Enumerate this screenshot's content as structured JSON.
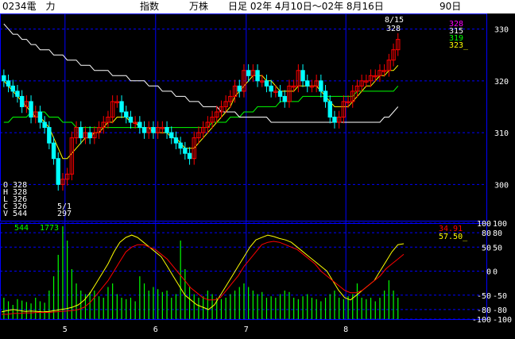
{
  "header": {
    "code_name": "0234電　力",
    "index_label": "指数",
    "unit_label": "万株",
    "period_label": "日足 02年 4月10日～02年 8月16日",
    "days_label": "90日"
  },
  "colors": {
    "background": "#000000",
    "grid": "#0000ff",
    "candle_up": "#ff0000",
    "candle_down": "#00ffff",
    "ma_short": "#ffff00",
    "ma_mid": "#00ff00",
    "ma_long": "#ffffff",
    "ma_extra": "#ff00ff",
    "volume": "#00ff00",
    "osc_fast": "#ffff00",
    "osc_slow": "#ff0000",
    "axis_text": "#ffffff"
  },
  "chart_data": [
    {
      "type": "candlestick",
      "title": "",
      "ylim": [
        293,
        333
      ],
      "yticks": [
        300,
        310,
        320,
        330
      ],
      "x_months": [
        {
          "label": "5",
          "index": 14
        },
        {
          "label": "6",
          "index": 34
        },
        {
          "label": "7",
          "index": 54
        },
        {
          "label": "8",
          "index": 76
        }
      ],
      "closes": [
        320,
        319,
        318,
        317,
        315,
        316,
        313,
        314,
        312,
        311,
        308,
        305,
        300,
        301,
        302,
        309,
        311,
        309,
        310,
        309,
        310,
        311,
        312,
        313,
        316,
        316,
        314,
        313,
        312,
        312,
        311,
        310,
        311,
        310,
        311,
        311,
        310,
        309,
        308,
        307,
        306,
        305,
        309,
        310,
        311,
        312,
        313,
        314,
        315,
        316,
        317,
        319,
        318,
        322,
        321,
        322,
        320,
        320,
        319,
        318,
        318,
        317,
        316,
        319,
        319,
        322,
        320,
        319,
        319,
        320,
        318,
        316,
        313,
        312,
        313,
        316,
        316,
        318,
        319,
        320,
        320,
        321,
        321,
        322,
        322,
        324,
        326,
        328
      ],
      "ohlc_last": {
        "date": "8/15",
        "O": "328",
        "H": "328",
        "L": "326",
        "C": "326",
        "V": "544"
      },
      "min_label": {
        "date": "5/1",
        "value": "297"
      },
      "series": [
        {
          "name": "",
          "values": [
            320,
            319,
            318,
            317,
            316,
            315,
            314,
            313,
            313,
            312,
            311,
            309,
            307,
            305,
            305,
            306,
            307,
            308,
            309,
            309,
            310,
            310,
            311,
            312,
            312,
            313,
            313,
            313,
            312,
            312,
            311,
            311,
            311,
            310,
            310,
            310,
            310,
            309,
            309,
            308,
            307,
            307,
            307,
            308,
            309,
            310,
            311,
            312,
            313,
            314,
            315,
            317,
            318,
            319,
            320,
            321,
            321,
            321,
            320,
            320,
            319,
            318,
            318,
            318,
            318,
            319,
            319,
            319,
            319,
            319,
            318,
            317,
            316,
            315,
            315,
            315,
            315,
            316,
            317,
            318,
            319,
            319,
            320,
            321,
            321,
            322,
            322,
            323
          ]
        },
        {
          "name": "",
          "values": [
            312,
            312,
            313,
            313,
            313,
            313,
            314,
            314,
            314,
            314,
            313,
            313,
            313,
            312,
            312,
            312,
            311,
            311,
            311,
            311,
            311,
            311,
            311,
            311,
            311,
            311,
            311,
            311,
            311,
            311,
            311,
            311,
            311,
            311,
            311,
            311,
            311,
            311,
            311,
            311,
            311,
            311,
            311,
            311,
            311,
            311,
            312,
            312,
            312,
            312,
            313,
            313,
            313,
            314,
            314,
            314,
            315,
            315,
            315,
            315,
            315,
            316,
            316,
            316,
            316,
            316,
            317,
            317,
            317,
            317,
            317,
            317,
            317,
            317,
            317,
            317,
            317,
            317,
            318,
            318,
            318,
            318,
            318,
            318,
            318,
            318,
            318,
            319
          ]
        },
        {
          "name": "",
          "values": [
            331,
            330,
            329,
            329,
            328,
            328,
            327,
            327,
            326,
            326,
            326,
            325,
            325,
            325,
            324,
            324,
            324,
            323,
            323,
            323,
            322,
            322,
            322,
            322,
            321,
            321,
            321,
            321,
            320,
            320,
            320,
            320,
            319,
            319,
            319,
            318,
            318,
            318,
            317,
            317,
            317,
            316,
            316,
            316,
            315,
            315,
            315,
            315,
            314,
            314,
            314,
            314,
            313,
            313,
            313,
            313,
            313,
            313,
            313,
            312,
            312,
            312,
            312,
            312,
            312,
            312,
            312,
            312,
            312,
            312,
            312,
            312,
            312,
            312,
            312,
            312,
            312,
            312,
            312,
            312,
            312,
            312,
            312,
            312,
            313,
            313,
            314,
            315
          ]
        }
      ],
      "legend_values": [
        "328",
        "315",
        "319",
        "323_"
      ]
    },
    {
      "type": "bar",
      "title": "",
      "labels": [
        "544",
        "1773"
      ],
      "volumes": [
        300,
        250,
        200,
        280,
        260,
        240,
        220,
        300,
        250,
        230,
        400,
        600,
        900,
        1300,
        1100,
        700,
        500,
        400,
        350,
        380,
        400,
        320,
        300,
        450,
        500,
        350,
        300,
        280,
        300,
        250,
        600,
        500,
        400,
        450,
        420,
        380,
        400,
        300,
        350,
        1100,
        700,
        450,
        350,
        300,
        320,
        400,
        350,
        300,
        280,
        300,
        350,
        400,
        450,
        500,
        450,
        400,
        350,
        380,
        300,
        320,
        300,
        350,
        400,
        380,
        300,
        280,
        320,
        350,
        300,
        280,
        250,
        300,
        350,
        400,
        300,
        280,
        320,
        350,
        500,
        300,
        280,
        300,
        250,
        300,
        400,
        544,
        400,
        300
      ]
    },
    {
      "type": "line",
      "title": "",
      "ylim": [
        -100,
        100
      ],
      "yticks": [
        100,
        80,
        50,
        0,
        -50,
        -80,
        -100
      ],
      "legend_values": [
        "34.91",
        "57.50_"
      ],
      "series": [
        {
          "name": "",
          "values": [
            -85,
            -82,
            -80,
            -82,
            -84,
            -83,
            -84,
            -85,
            -84,
            -82,
            -80,
            -78,
            -75,
            -70,
            -60,
            -45,
            -25,
            -5,
            15,
            40,
            60,
            70,
            75,
            70,
            60,
            50,
            40,
            30,
            10,
            -10,
            -30,
            -50,
            -60,
            -70,
            -75,
            -80,
            -70,
            -50,
            -30,
            -10,
            10,
            30,
            50,
            65,
            70,
            75,
            72,
            68,
            65,
            60,
            50,
            40,
            30,
            20,
            10,
            0,
            -20,
            -40,
            -55,
            -60,
            -50,
            -40,
            -30,
            -20,
            0,
            20,
            40,
            55,
            57
          ]
        },
        {
          "name": "",
          "values": [
            -90,
            -90,
            -88,
            -88,
            -87,
            -87,
            -86,
            -86,
            -86,
            -85,
            -84,
            -83,
            -82,
            -80,
            -75,
            -65,
            -50,
            -35,
            -20,
            0,
            20,
            40,
            50,
            55,
            55,
            50,
            45,
            35,
            25,
            10,
            -5,
            -20,
            -35,
            -45,
            -55,
            -60,
            -60,
            -55,
            -40,
            -25,
            -10,
            10,
            25,
            40,
            55,
            60,
            62,
            60,
            55,
            50,
            45,
            35,
            25,
            15,
            0,
            -10,
            -20,
            -30,
            -40,
            -45,
            -45,
            -40,
            -30,
            -20,
            -10,
            5,
            15,
            25,
            35
          ]
        }
      ]
    }
  ]
}
